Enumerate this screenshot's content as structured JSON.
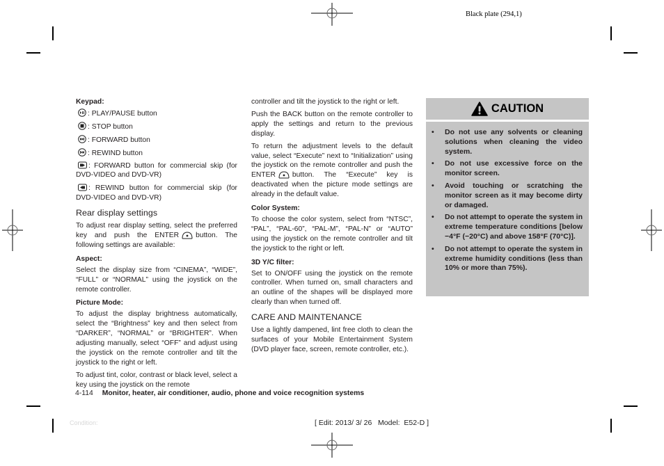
{
  "plate_label": "Black plate (294,1)",
  "left_column": {
    "keypad_heading": "Keypad:",
    "keypad_items": [
      {
        "icon": "play-pause-icon",
        "text": ": PLAY/PAUSE button"
      },
      {
        "icon": "stop-icon",
        "text": ": STOP button"
      },
      {
        "icon": "forward-icon",
        "text": ": FORWARD button"
      },
      {
        "icon": "rewind-icon",
        "text": ": REWIND button"
      },
      {
        "icon": "commercial-skip-forward-icon",
        "text": ": FORWARD button for commercial skip (for DVD-VIDEO and DVD-VR)"
      },
      {
        "icon": "commercial-skip-rewind-icon",
        "text": ": REWIND button for commercial skip (for DVD-VIDEO and DVD-VR)"
      }
    ],
    "rear_display_heading": "Rear display settings",
    "rear_display_text_before": "To adjust rear display setting, select the preferred key and push the ENTER",
    "rear_display_text_after": "button. The following settings are available:",
    "aspect_heading": "Aspect:",
    "aspect_text": "Select the display size from “CINEMA”, “WIDE”, “FULL” or “NORMAL” using the joystick on the remote controller.",
    "picture_mode_heading": "Picture Mode:",
    "picture_mode_text1": "To adjust the display brightness automatically, select the “Brightness” key and then select from “DARKER”, “NORMAL” or “BRIGHTER”. When adjusting manually, select “OFF” and adjust using the joystick on the remote controller and tilt the joystick to the right or left.",
    "picture_mode_text2": "To adjust tint, color, contrast or black level, select a key using the joystick on the remote"
  },
  "middle_column": {
    "continued_text": "controller and tilt the joystick to the right or left.",
    "back_text": "Push the BACK button on the remote controller to apply the settings and return to the previous display.",
    "default_text_before": "To return the adjustment levels to the default value, select “Execute” next to “Initialization” using the joystick on the remote controller and push the ENTER",
    "default_text_after": "button. The “Execute” key is deactivated when the picture mode settings are already in the default value.",
    "color_system_heading": "Color System:",
    "color_system_text": "To choose the color system, select from “NTSC”, “PAL”, “PAL-60”, “PAL-M”, “PAL-N” or “AUTO” using the joystick on the remote controller and tilt the joystick to the right or left.",
    "yc_filter_heading": "3D Y/C filter:",
    "yc_filter_text": "Set to ON/OFF using the joystick on the remote controller. When turned on, small characters and an outline of the shapes will be displayed more clearly than when turned off.",
    "care_heading": "CARE AND MAINTENANCE",
    "care_text": "Use a lightly dampened, lint free cloth to clean the surfaces of your Mobile Entertainment System (DVD player face, screen, remote controller, etc.)."
  },
  "caution": {
    "title": "CAUTION",
    "bg_color": "#c5c5c5",
    "items": [
      "Do not use any solvents or cleaning solutions when cleaning the video system.",
      "Do not use excessive force on the monitor screen.",
      "Avoid touching or scratching the monitor screen as it may become dirty or damaged.",
      "Do not attempt to operate the system in extreme temperature con­ditions [below −4°F (−20°C) and above 158°F (70°C)].",
      "Do not attempt to operate the system in extreme humidity condi­tions (less than 10% or more than 75%)."
    ]
  },
  "footer": {
    "page_number": "4-114",
    "section_title": "Monitor, heater, air conditioner, audio, phone and voice recognition systems",
    "condition_label": "Condition:",
    "edit_info": "[ Edit: 2013/ 3/ 26   Model:  E52-D ]"
  }
}
